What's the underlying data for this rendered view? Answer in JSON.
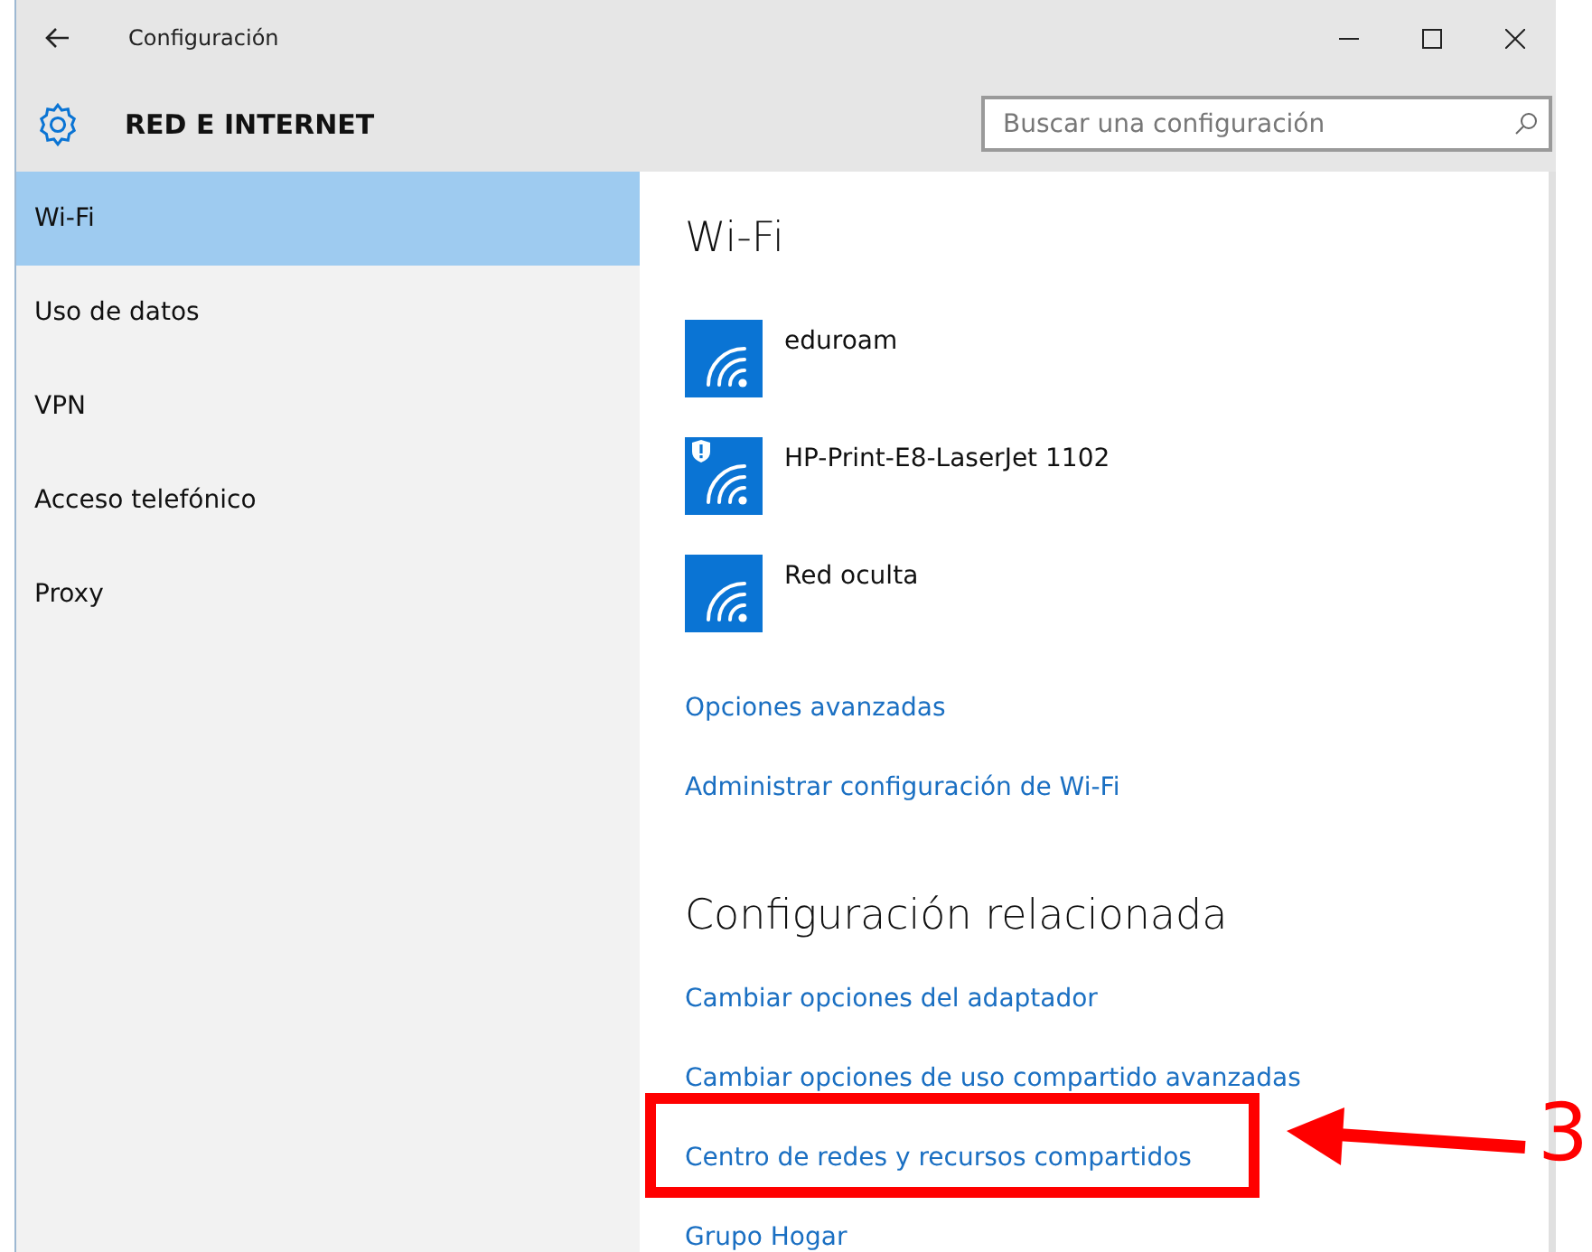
{
  "window": {
    "title": "Configuración"
  },
  "header": {
    "title": "RED E INTERNET",
    "search": {
      "placeholder": "Buscar una configuración"
    }
  },
  "sidebar": {
    "items": [
      {
        "label": "Wi-Fi",
        "selected": true
      },
      {
        "label": "Uso de datos",
        "selected": false
      },
      {
        "label": "VPN",
        "selected": false
      },
      {
        "label": "Acceso telefónico",
        "selected": false
      },
      {
        "label": "Proxy",
        "selected": false
      }
    ]
  },
  "content": {
    "heading": "Wi-Fi",
    "networks": [
      {
        "name": "eduroam",
        "warning": false
      },
      {
        "name": "HP-Print-E8-LaserJet 1102",
        "warning": true
      },
      {
        "name": "Red oculta",
        "warning": false
      }
    ],
    "links": [
      {
        "label": "Opciones avanzadas",
        "highlighted": false
      },
      {
        "label": "Administrar configuración de Wi-Fi",
        "highlighted": false
      }
    ],
    "related": {
      "heading": "Configuración relacionada",
      "links": [
        {
          "label": "Cambiar opciones del adaptador",
          "highlighted": false
        },
        {
          "label": "Cambiar opciones de uso compartido avanzadas",
          "highlighted": false
        },
        {
          "label": "Centro de redes y recursos compartidos",
          "highlighted": true
        },
        {
          "label": "Grupo Hogar",
          "highlighted": false
        }
      ]
    }
  },
  "annotation": {
    "label": "3"
  }
}
